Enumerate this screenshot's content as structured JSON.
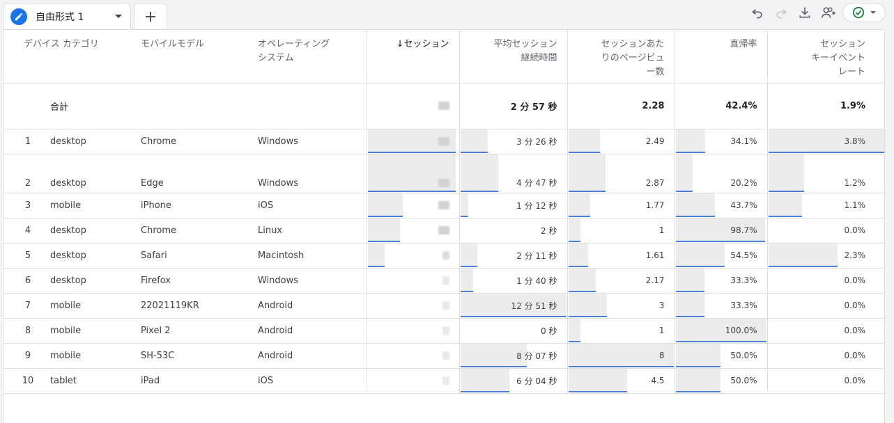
{
  "tab": {
    "label": "自由形式 1"
  },
  "toolbar": {
    "icons": [
      "undo-icon",
      "redo-icon",
      "download-icon",
      "share-user-icon",
      "check-circle-icon"
    ]
  },
  "table": {
    "headers": [
      "デバイス カテゴリ",
      "モバイルモデル",
      "オペレーティング\nシステム",
      "↓セッション",
      "平均セッション\n継続時間",
      "セッションあた\nりのページビュ\nー数",
      "直帰率",
      "セッション\nキーイベント\nレート"
    ],
    "total": {
      "label": "合計",
      "avg_duration": "2 分 57 秒",
      "pages_per_session": "2.28",
      "bounce_rate": "42.4%",
      "key_event_rate": "1.9%"
    },
    "rows": [
      {
        "index": "1",
        "device": "desktop",
        "model": "Chrome",
        "os": "Windows",
        "duration": "3 分 26 秒",
        "pages": "2.49",
        "bounce": "34.1%",
        "kev": "3.8%",
        "sessions_share": 0.97,
        "duration_share": 0.27,
        "pages_share": 0.31,
        "bounce_share": 0.34,
        "kev_share": 1.0
      },
      {
        "index": "2",
        "device": "desktop",
        "model": "Edge",
        "os": "Windows",
        "duration": "4 分 47 秒",
        "pages": "2.87",
        "bounce": "20.2%",
        "kev": "1.2%",
        "sessions_share": 0.97,
        "duration_share": 0.37,
        "pages_share": 0.36,
        "bounce_share": 0.2,
        "kev_share": 0.32
      },
      {
        "index": "3",
        "device": "mobile",
        "model": "iPhone",
        "os": "iOS",
        "duration": "1 分 12 秒",
        "pages": "1.77",
        "bounce": "43.7%",
        "kev": "1.1%",
        "sessions_share": 0.4,
        "duration_share": 0.09,
        "pages_share": 0.22,
        "bounce_share": 0.44,
        "kev_share": 0.3
      },
      {
        "index": "4",
        "device": "desktop",
        "model": "Chrome",
        "os": "Linux",
        "duration": "2 秒",
        "pages": "1",
        "bounce": "98.7%",
        "kev": "0.0%",
        "sessions_share": 0.37,
        "duration_share": 0.0,
        "pages_share": 0.13,
        "bounce_share": 0.99,
        "kev_share": 0.0
      },
      {
        "index": "5",
        "device": "desktop",
        "model": "Safari",
        "os": "Macintosh",
        "duration": "2 分 11 秒",
        "pages": "1.61",
        "bounce": "54.5%",
        "kev": "2.3%",
        "sessions_share": 0.2,
        "duration_share": 0.17,
        "pages_share": 0.2,
        "bounce_share": 0.55,
        "kev_share": 0.6
      },
      {
        "index": "6",
        "device": "desktop",
        "model": "Firefox",
        "os": "Windows",
        "duration": "1 分 40 秒",
        "pages": "2.17",
        "bounce": "33.3%",
        "kev": "0.0%",
        "sessions_share": 0.01,
        "duration_share": 0.13,
        "pages_share": 0.27,
        "bounce_share": 0.33,
        "kev_share": 0.0
      },
      {
        "index": "7",
        "device": "mobile",
        "model": "22021119KR",
        "os": "Android",
        "duration": "12 分 51 秒",
        "pages": "3",
        "bounce": "33.3%",
        "kev": "0.0%",
        "sessions_share": 0.0,
        "duration_share": 1.0,
        "pages_share": 0.375,
        "bounce_share": 0.33,
        "kev_share": 0.0
      },
      {
        "index": "8",
        "device": "mobile",
        "model": "Pixel 2",
        "os": "Android",
        "duration": "0 秒",
        "pages": "1",
        "bounce": "100.0%",
        "kev": "0.0%",
        "sessions_share": 0.0,
        "duration_share": 0.0,
        "pages_share": 0.125,
        "bounce_share": 1.0,
        "kev_share": 0.0
      },
      {
        "index": "9",
        "device": "mobile",
        "model": "SH-53C",
        "os": "Android",
        "duration": "8 分 07 秒",
        "pages": "8",
        "bounce": "50.0%",
        "kev": "0.0%",
        "sessions_share": 0.0,
        "duration_share": 0.63,
        "pages_share": 1.0,
        "bounce_share": 0.5,
        "kev_share": 0.0
      },
      {
        "index": "10",
        "device": "tablet",
        "model": "iPad",
        "os": "iOS",
        "duration": "6 分 04 秒",
        "pages": "4.5",
        "bounce": "50.0%",
        "kev": "0.0%",
        "sessions_share": 0.0,
        "duration_share": 0.47,
        "pages_share": 0.5625,
        "bounce_share": 0.5,
        "kev_share": 0.0
      }
    ]
  },
  "colors": {
    "accent": "#1a73e8",
    "bar_fill": "#ececec",
    "bar_line": "#4a7fd4",
    "check_green": "#188038"
  }
}
